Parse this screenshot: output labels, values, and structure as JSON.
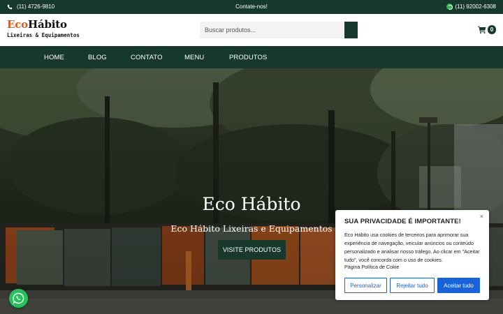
{
  "topbar": {
    "phone": "(11) 4726-9810",
    "contact_label": "Contate-nos!",
    "whatsapp": "(11) 92002-6308"
  },
  "header": {
    "logo_eco": "Eco",
    "logo_habito": "Hábito",
    "logo_sub": "Lixeiras & Equipamentos",
    "search_placeholder": "Buscar produtos...",
    "cart_count": "0"
  },
  "nav": {
    "items": [
      "HOME",
      "BLOG",
      "CONTATO",
      "MENU",
      "PRODUTOS"
    ]
  },
  "hero": {
    "title": "Eco Hábito",
    "subtitle": "Eco Hábito Lixeiras e Equipamentos",
    "button": "VISITE PRODUTOS"
  },
  "cookie": {
    "title": "SUA PRIVACIDADE É IMPORTANTE!",
    "body": "Eco Hábito usa cookies de terceiros para aprimorar sua experiência de navegação, veicular anúncios ou conteúdo personalizado e analisar nosso tráfego. Ao clicar em \"Aceitar tudo\", você concorda com o uso de cookies.",
    "policy_link": "Página Política de Cokie",
    "close": "×",
    "btn_customize": "Personalizar",
    "btn_reject": "Rejeitar tudo",
    "btn_accept": "Aceitar tudo"
  },
  "colors": {
    "brand_green": "#16392c",
    "accent_orange": "#e25a18",
    "cookie_blue": "#1863dc",
    "whatsapp_green": "#25c15a"
  },
  "icons": [
    "phone-icon",
    "whatsapp-icon",
    "search-icon",
    "cart-icon",
    "close-icon"
  ]
}
